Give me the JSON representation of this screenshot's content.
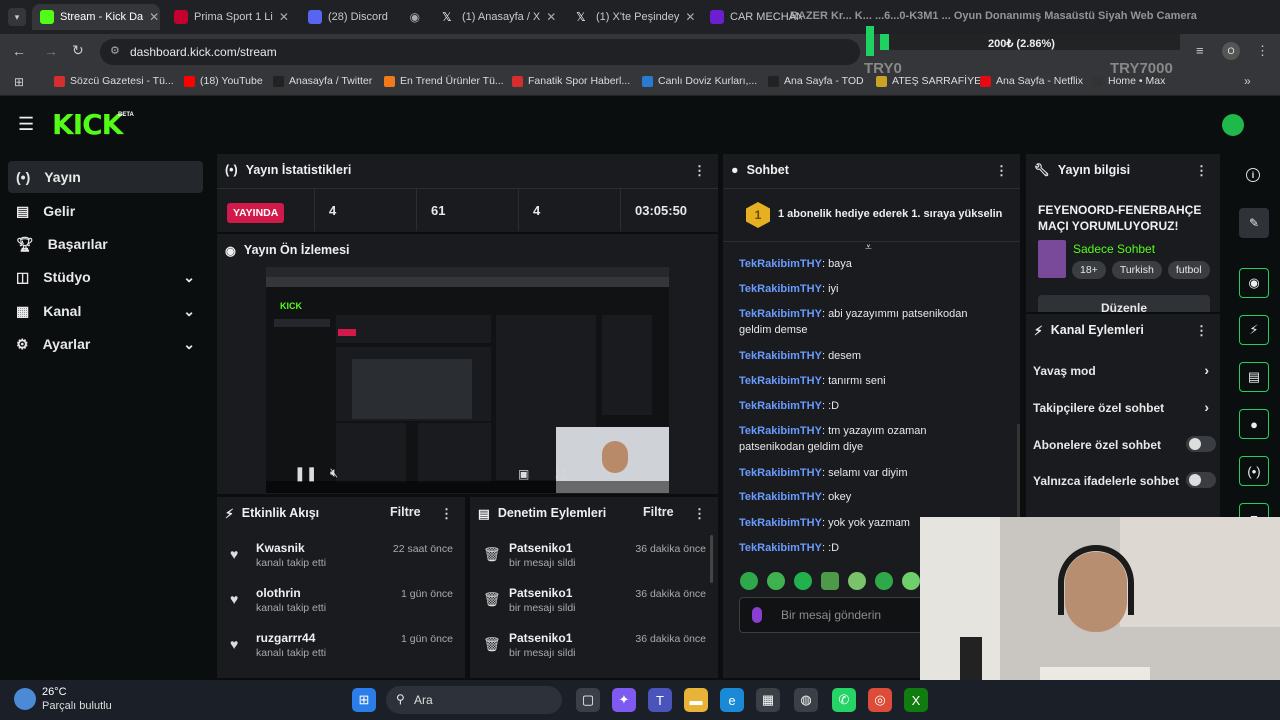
{
  "browser": {
    "tabs": [
      {
        "label": "Stream - Kick Da",
        "color": "#53fc18"
      },
      {
        "label": "Prima Sport 1 Li",
        "color": "#c4002e"
      },
      {
        "label": "(28) Discord",
        "color": "#5865f2"
      },
      {
        "label": "(1) Anasayfa / X",
        "color": "#222"
      },
      {
        "label": "(1) X'te Peşindey",
        "color": "#222"
      },
      {
        "label": "CAR MECHANI",
        "color": "#6b1fd1"
      }
    ],
    "url": "dashboard.kick.com/stream",
    "bookmarks": [
      {
        "label": "Sözcü Gazetesi - Tü...",
        "color": "#d32f2f"
      },
      {
        "label": "(18) YouTube",
        "color": "#ff0000"
      },
      {
        "label": "Anasayfa / Twitter",
        "color": "#222"
      },
      {
        "label": "En Trend Ürünler Tü...",
        "color": "#f27a1a"
      },
      {
        "label": "Fanatik Spor Haberl...",
        "color": "#d32f2f"
      },
      {
        "label": "Canlı Doviz Kurları,...",
        "color": "#2a7ad1"
      },
      {
        "label": "Ana Sayfa - TOD",
        "color": "#222"
      },
      {
        "label": "ATEŞ SARRAFİYE",
        "color": "#c9a227"
      },
      {
        "label": "Ana Sayfa - Netflix",
        "color": "#e50914"
      },
      {
        "label": "Home • Max",
        "color": "#333"
      }
    ]
  },
  "overlay": {
    "title_text": "RAZER Kr... K... ...6...0-K3M1 ... Oyun Donanımış Masaüstü Siyah Web Camera",
    "amount": "200₺ (2.86%)",
    "left_label": "TRY0",
    "right_label": "TRY7000",
    "progress": 0.0286
  },
  "brand": {
    "logo": "KICK",
    "beta": "BETA",
    "accent": "#53fc18"
  },
  "sidebar": {
    "items": [
      {
        "label": "Yayın",
        "icon": "broadcast-icon"
      },
      {
        "label": "Gelir",
        "icon": "revenue-icon"
      },
      {
        "label": "Başarılar",
        "icon": "trophy-icon"
      },
      {
        "label": "Stüdyo",
        "icon": "studio-icon"
      },
      {
        "label": "Kanal",
        "icon": "channel-icon"
      },
      {
        "label": "Ayarlar",
        "icon": "gear-icon"
      }
    ]
  },
  "stats": {
    "title": "Yayın İstatistikleri",
    "live_badge": "YAYINDA",
    "values": [
      "4",
      "61",
      "4",
      "03:05:50"
    ]
  },
  "preview": {
    "title": "Yayın Ön İzlemesi"
  },
  "activity": {
    "title": "Etkinlik Akışı",
    "filter": "Filtre",
    "items": [
      {
        "name": "Kwasnik",
        "sub": "kanalı takip etti",
        "time": "22 saat önce"
      },
      {
        "name": "olothrin",
        "sub": "kanalı takip etti",
        "time": "1 gün önce"
      },
      {
        "name": "ruzgarrr44",
        "sub": "kanalı takip etti",
        "time": "1 gün önce"
      }
    ]
  },
  "moderation": {
    "title": "Denetim Eylemleri",
    "filter": "Filtre",
    "items": [
      {
        "name": "Patseniko1",
        "sub": "bir mesajı sildi",
        "time": "36 dakika önce"
      },
      {
        "name": "Patseniko1",
        "sub": "bir mesajı sildi",
        "time": "36 dakika önce"
      },
      {
        "name": "Patseniko1",
        "sub": "bir mesajı sildi",
        "time": "36 dakika önce"
      }
    ]
  },
  "chat": {
    "title": "Sohbet",
    "pinned_badge": "1",
    "pinned": "1 abonelik hediye ederek 1. sıraya yükselin",
    "messages": [
      {
        "user": "TekRakibimTHY",
        "text": "baya"
      },
      {
        "user": "TekRakibimTHY",
        "text": "iyi"
      },
      {
        "user": "TekRakibimTHY",
        "text": "abi yazayımmı patsenikodan geldim demse"
      },
      {
        "user": "TekRakibimTHY",
        "text": "desem"
      },
      {
        "user": "TekRakibimTHY",
        "text": "tanırmı seni"
      },
      {
        "user": "TekRakibimTHY",
        "text": ":D"
      },
      {
        "user": "TekRakibimTHY",
        "text": "tm yazayım ozaman patsenikodan geldim diye"
      },
      {
        "user": "TekRakibimTHY",
        "text": "selamı var diyim"
      },
      {
        "user": "TekRakibimTHY",
        "text": "okey"
      },
      {
        "user": "TekRakibimTHY",
        "text": "yok yok yazmam"
      },
      {
        "user": "TekRakibimTHY",
        "text": ":D"
      }
    ],
    "placeholder": "Bir mesaj gönderin"
  },
  "info": {
    "title": "Yayın bilgisi",
    "stream_title": "FEYENOORD-FENERBAHÇE MAÇI YORUMLUYORUZ!",
    "category": "Sadece Sohbet",
    "tags": [
      "18+",
      "Turkish",
      "futbol"
    ],
    "edit": "Düzenle"
  },
  "actions": {
    "title": "Kanal Eylemleri",
    "items": [
      {
        "label": "Yavaş mod",
        "kind": "arrow"
      },
      {
        "label": "Takipçilere özel sohbet",
        "kind": "arrow"
      },
      {
        "label": "Abonelere özel sohbet",
        "kind": "toggle"
      },
      {
        "label": "Yalnızca ifadelerle sohbet",
        "kind": "toggle"
      }
    ]
  },
  "taskbar": {
    "temp": "26°C",
    "weather": "Parçalı bulutlu",
    "search": "Ara"
  }
}
